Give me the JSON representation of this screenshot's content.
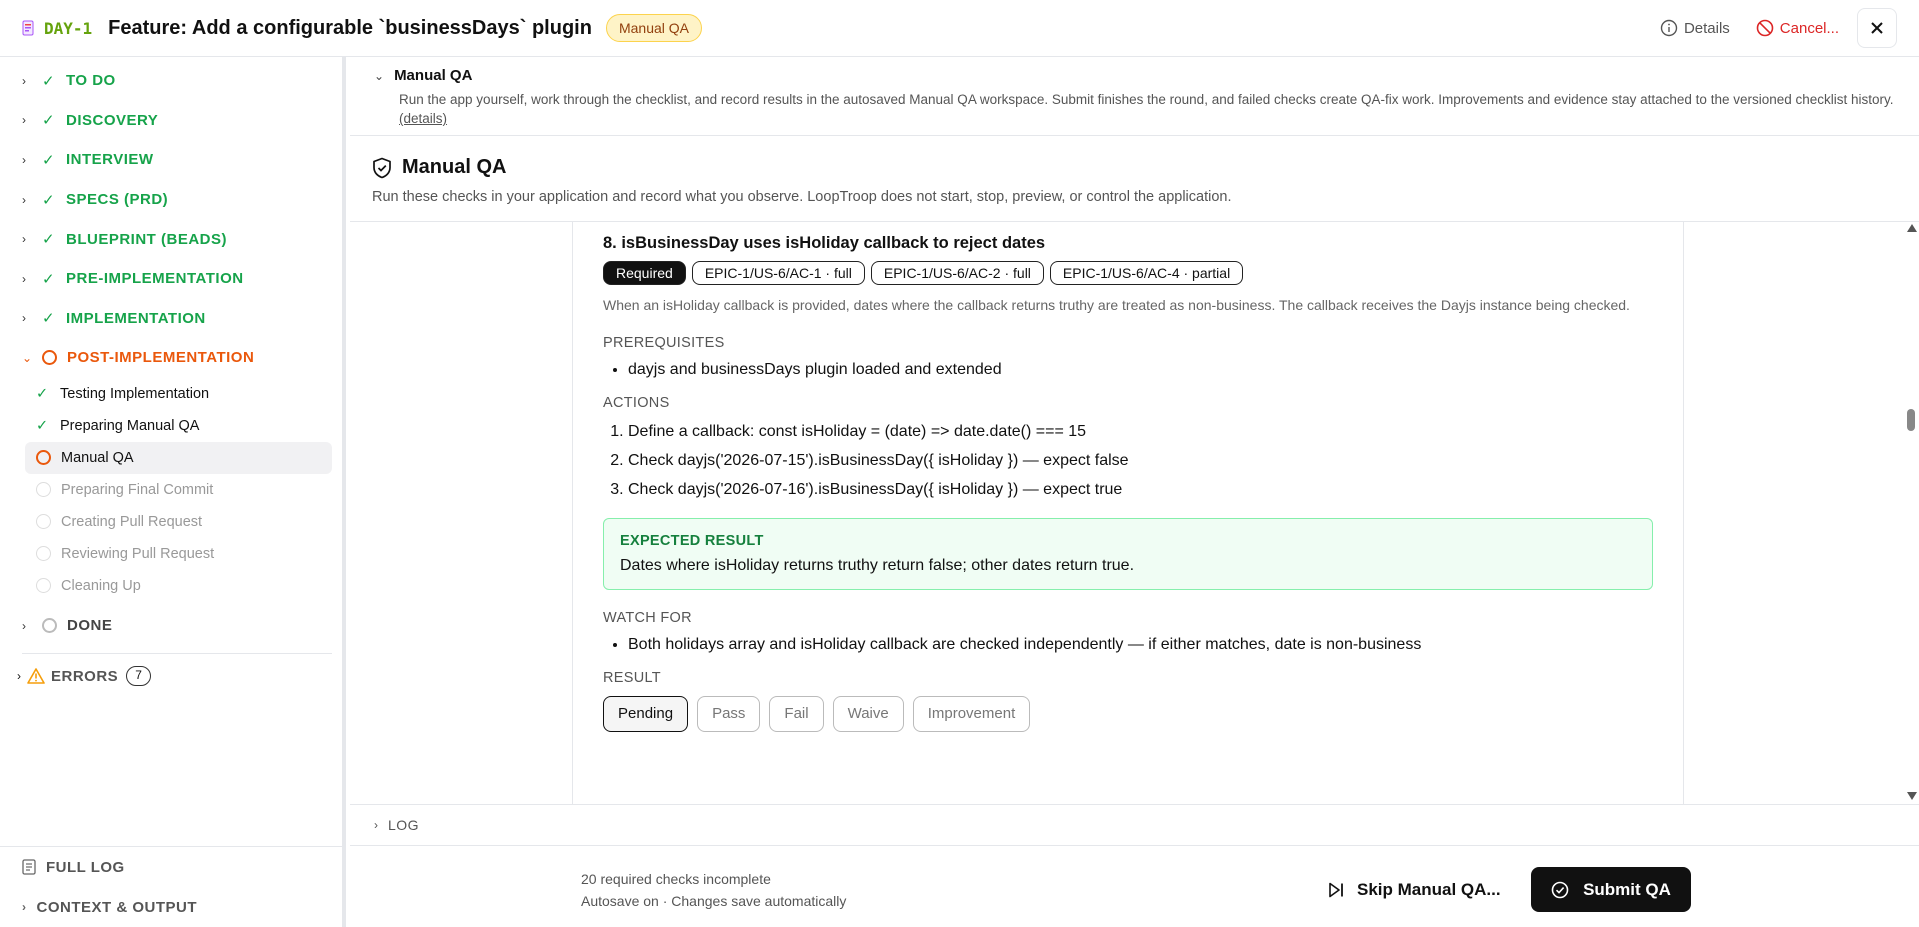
{
  "header": {
    "ticket_id": "DAY-1",
    "title": "Feature: Add a configurable `businessDays` plugin",
    "status_badge": "Manual QA",
    "details_label": "Details",
    "cancel_label": "Cancel..."
  },
  "sidebar": {
    "phases_done": [
      {
        "label": "TO DO"
      },
      {
        "label": "DISCOVERY"
      },
      {
        "label": "INTERVIEW"
      },
      {
        "label": "SPECS (PRD)"
      },
      {
        "label": "BLUEPRINT (BEADS)"
      },
      {
        "label": "PRE-IMPLEMENTATION"
      },
      {
        "label": "IMPLEMENTATION"
      }
    ],
    "active_phase": "POST-IMPLEMENTATION",
    "substeps": [
      {
        "label": "Testing Implementation"
      },
      {
        "label": "Preparing Manual QA"
      },
      {
        "label": "Manual QA"
      },
      {
        "label": "Preparing Final Commit"
      },
      {
        "label": "Creating Pull Request"
      },
      {
        "label": "Reviewing Pull Request"
      },
      {
        "label": "Cleaning Up"
      }
    ],
    "done_phase": "DONE",
    "errors_label": "ERRORS",
    "errors_count": "7",
    "full_log": "FULL LOG",
    "context_output": "CONTEXT & OUTPUT"
  },
  "qa_header": {
    "title": "Manual QA",
    "description": "Run the app yourself, work through the checklist, and record results in the autosaved Manual QA workspace. Submit finishes the round, and failed checks create QA-fix work. Improvements and evidence stay attached to the versioned checklist history.",
    "details_link": "(details)"
  },
  "qa_section": {
    "title": "Manual QA",
    "subtitle": "Run these checks in your application and record what you observe. LoopTroop does not start, stop, preview, or control the application."
  },
  "check": {
    "title": "8. isBusinessDay uses isHoliday callback to reject dates",
    "tags": [
      "Required",
      "EPIC-1/US-6/AC-1 · full",
      "EPIC-1/US-6/AC-2 · full",
      "EPIC-1/US-6/AC-4 · partial"
    ],
    "description": "When an isHoliday callback is provided, dates where the callback returns truthy are treated as non-business. The callback receives the Dayjs instance being checked.",
    "prerequisites_label": "PREREQUISITES",
    "prerequisites": [
      "dayjs and businessDays plugin loaded and extended"
    ],
    "actions_label": "ACTIONS",
    "actions": [
      "Define a callback: const isHoliday = (date) => date.date() === 15",
      "Check dayjs('2026-07-15').isBusinessDay({ isHoliday }) — expect false",
      "Check dayjs('2026-07-16').isBusinessDay({ isHoliday }) — expect true"
    ],
    "expected_label": "EXPECTED RESULT",
    "expected": "Dates where isHoliday returns truthy return false; other dates return true.",
    "watch_label": "WATCH FOR",
    "watch": [
      "Both holidays array and isHoliday callback are checked independently — if either matches, date is non-business"
    ],
    "result_label": "RESULT",
    "result_options": [
      "Pending",
      "Pass",
      "Fail",
      "Waive",
      "Improvement"
    ],
    "result_selected": "Pending"
  },
  "log_label": "LOG",
  "footer": {
    "status_line1": "20 required checks incomplete",
    "status_line2": "Autosave on · Changes save automatically",
    "skip_label": "Skip Manual QA...",
    "submit_label": "Submit QA"
  },
  "colors": {
    "done_green": "#16a34a",
    "active_orange": "#ea580c",
    "ticket_green": "#65a30d",
    "cancel_red": "#dc2626",
    "badge_bg": "#fef3c7"
  }
}
